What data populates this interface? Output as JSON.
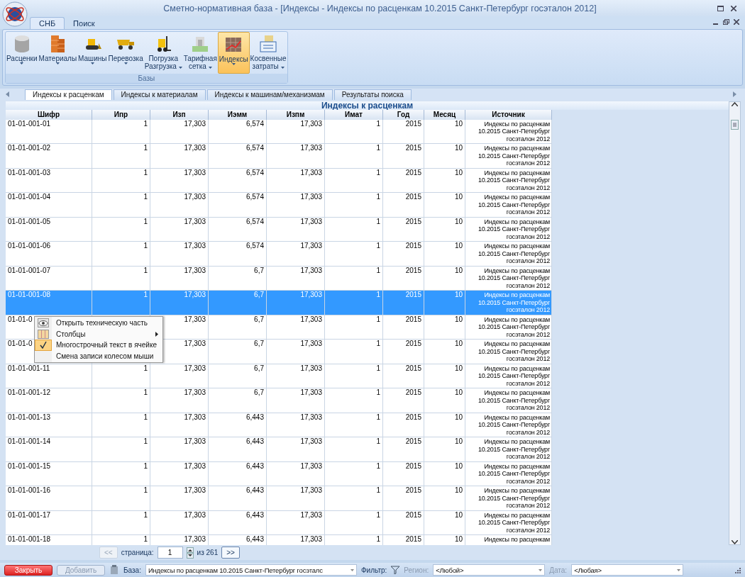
{
  "window": {
    "title": "Сметно-нормативная база - [Индексы - Индексы по расценкам 10.2015 Санкт-Петербург госэталон 2012]"
  },
  "ribbon": {
    "tabs": [
      {
        "label": "СНБ",
        "selected": true
      },
      {
        "label": "Поиск",
        "selected": false
      }
    ],
    "group": {
      "label": "Базы",
      "buttons": [
        {
          "lines": [
            "Расценки"
          ],
          "selected": false
        },
        {
          "lines": [
            "Материалы"
          ],
          "selected": false
        },
        {
          "lines": [
            "Машины"
          ],
          "selected": false
        },
        {
          "lines": [
            "Перевозка"
          ],
          "selected": false
        },
        {
          "lines": [
            "Погрузка",
            "Разгрузка"
          ],
          "selected": false
        },
        {
          "lines": [
            "Тарифная",
            "сетка"
          ],
          "selected": false
        },
        {
          "lines": [
            "Индексы"
          ],
          "selected": true
        },
        {
          "lines": [
            "Косвенные",
            "затраты"
          ],
          "selected": false
        }
      ]
    }
  },
  "doc_tabs": [
    {
      "label": "Индексы к расценкам",
      "selected": true
    },
    {
      "label": "Индексы к материалам",
      "selected": false
    },
    {
      "label": "Индексы к машинам/механизмам",
      "selected": false
    },
    {
      "label": "Результаты поиска",
      "selected": false
    }
  ],
  "grid": {
    "title": "Индексы к расценкам",
    "columns": [
      "Шифр",
      "Ипр",
      "Изп",
      "Иэмм",
      "Изпм",
      "Имат",
      "Год",
      "Месяц",
      "Источник"
    ],
    "rows": [
      {
        "selected": false,
        "cells": [
          "01-01-001-01",
          "1",
          "17,303",
          "6,574",
          "17,303",
          "1",
          "2015",
          "10",
          "Индексы по расценкам 10.2015 Санкт-Петербург госэталон 2012"
        ]
      },
      {
        "selected": false,
        "cells": [
          "01-01-001-02",
          "1",
          "17,303",
          "6,574",
          "17,303",
          "1",
          "2015",
          "10",
          "Индексы по расценкам 10.2015 Санкт-Петербург госэталон 2012"
        ]
      },
      {
        "selected": false,
        "cells": [
          "01-01-001-03",
          "1",
          "17,303",
          "6,574",
          "17,303",
          "1",
          "2015",
          "10",
          "Индексы по расценкам 10.2015 Санкт-Петербург госэталон 2012"
        ]
      },
      {
        "selected": false,
        "cells": [
          "01-01-001-04",
          "1",
          "17,303",
          "6,574",
          "17,303",
          "1",
          "2015",
          "10",
          "Индексы по расценкам 10.2015 Санкт-Петербург госэталон 2012"
        ]
      },
      {
        "selected": false,
        "cells": [
          "01-01-001-05",
          "1",
          "17,303",
          "6,574",
          "17,303",
          "1",
          "2015",
          "10",
          "Индексы по расценкам 10.2015 Санкт-Петербург госэталон 2012"
        ]
      },
      {
        "selected": false,
        "cells": [
          "01-01-001-06",
          "1",
          "17,303",
          "6,574",
          "17,303",
          "1",
          "2015",
          "10",
          "Индексы по расценкам 10.2015 Санкт-Петербург госэталон 2012"
        ]
      },
      {
        "selected": false,
        "cells": [
          "01-01-001-07",
          "1",
          "17,303",
          "6,7",
          "17,303",
          "1",
          "2015",
          "10",
          "Индексы по расценкам 10.2015 Санкт-Петербург госэталон 2012"
        ]
      },
      {
        "selected": true,
        "cells": [
          "01-01-001-08",
          "1",
          "17,303",
          "6,7",
          "17,303",
          "1",
          "2015",
          "10",
          "Индексы по расценкам 10.2015 Санкт-Петербург госэталон 2012"
        ]
      },
      {
        "selected": false,
        "cells": [
          "01-01-0",
          null,
          "17,303",
          "6,7",
          "17,303",
          "1",
          "2015",
          "10",
          "Индексы по расценкам 10.2015 Санкт-Петербург госэталон 2012"
        ]
      },
      {
        "selected": false,
        "cells": [
          "01-01-0",
          null,
          "17,303",
          "6,7",
          "17,303",
          "1",
          "2015",
          "10",
          "Индексы по расценкам 10.2015 Санкт-Петербург госэталон 2012"
        ]
      },
      {
        "selected": false,
        "cells": [
          "01-01-001-11",
          "1",
          "17,303",
          "6,7",
          "17,303",
          "1",
          "2015",
          "10",
          "Индексы по расценкам 10.2015 Санкт-Петербург госэталон 2012"
        ]
      },
      {
        "selected": false,
        "cells": [
          "01-01-001-12",
          "1",
          "17,303",
          "6,7",
          "17,303",
          "1",
          "2015",
          "10",
          "Индексы по расценкам 10.2015 Санкт-Петербург госэталон 2012"
        ]
      },
      {
        "selected": false,
        "cells": [
          "01-01-001-13",
          "1",
          "17,303",
          "6,443",
          "17,303",
          "1",
          "2015",
          "10",
          "Индексы по расценкам 10.2015 Санкт-Петербург госэталон 2012"
        ]
      },
      {
        "selected": false,
        "cells": [
          "01-01-001-14",
          "1",
          "17,303",
          "6,443",
          "17,303",
          "1",
          "2015",
          "10",
          "Индексы по расценкам 10.2015 Санкт-Петербург госэталон 2012"
        ]
      },
      {
        "selected": false,
        "cells": [
          "01-01-001-15",
          "1",
          "17,303",
          "6,443",
          "17,303",
          "1",
          "2015",
          "10",
          "Индексы по расценкам 10.2015 Санкт-Петербург госэталон 2012"
        ]
      },
      {
        "selected": false,
        "cells": [
          "01-01-001-16",
          "1",
          "17,303",
          "6,443",
          "17,303",
          "1",
          "2015",
          "10",
          "Индексы по расценкам 10.2015 Санкт-Петербург госэталон 2012"
        ]
      },
      {
        "selected": false,
        "cells": [
          "01-01-001-17",
          "1",
          "17,303",
          "6,443",
          "17,303",
          "1",
          "2015",
          "10",
          "Индексы по расценкам 10.2015 Санкт-Петербург госэталон 2012"
        ]
      },
      {
        "selected": false,
        "cells": [
          "01-01-001-18",
          "1",
          "17,303",
          "6,443",
          "17,303",
          "1",
          "2015",
          "10",
          "Индексы по расценкам"
        ]
      }
    ]
  },
  "context_menu": {
    "items": [
      {
        "label": "Открыть техническую часть",
        "checked": false,
        "submenu": false
      },
      {
        "label": "Столбцы",
        "checked": false,
        "submenu": true
      },
      {
        "label": "Многострочный текст в ячейке",
        "checked": true,
        "submenu": false
      },
      {
        "label": "Смена записи колесом мыши",
        "checked": false,
        "submenu": false
      }
    ]
  },
  "pager": {
    "prev": {
      "label": "<<",
      "disabled": true
    },
    "label": "страница:",
    "page": "1",
    "total": "из 261",
    "next": {
      "label": ">>",
      "disabled": false
    }
  },
  "status_bar": {
    "close": {
      "label": "Закрыть"
    },
    "add": {
      "label": "Добавить",
      "disabled": true
    },
    "items": [
      {
        "kind": "field",
        "label": "База:",
        "value": "Индексы по расценкам 10.2015 Санкт-Петербург госэталс",
        "disabled": false
      },
      {
        "kind": "filter",
        "label": "Фильтр:",
        "disabled": false
      },
      {
        "kind": "field",
        "label": "Регион:",
        "value": "<Любой>",
        "disabled": true
      },
      {
        "kind": "field",
        "label": "Дата:",
        "value": "<Любая>",
        "disabled": true
      }
    ]
  }
}
